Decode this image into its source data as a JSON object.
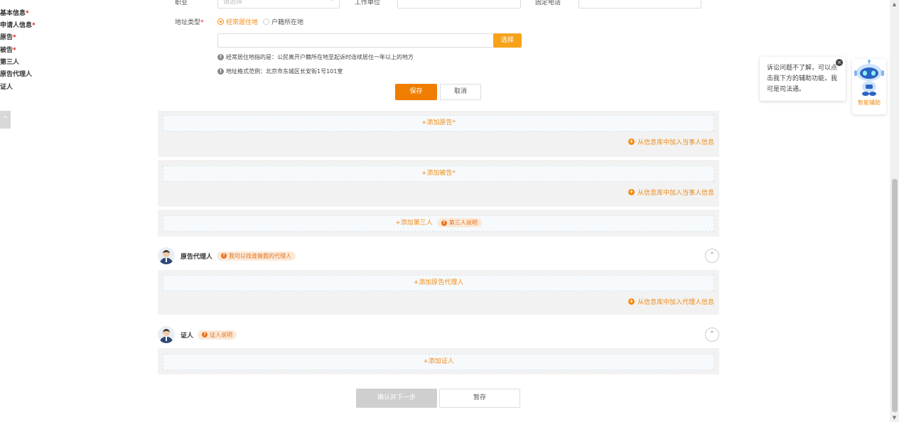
{
  "nav": {
    "items": [
      {
        "label": "基本信息",
        "required": true
      },
      {
        "label": "申请人信息",
        "required": true
      },
      {
        "label": "原告",
        "required": true
      },
      {
        "label": "被告",
        "required": true
      },
      {
        "label": "第三人",
        "required": false
      },
      {
        "label": "原告代理人",
        "required": false
      },
      {
        "label": "证人",
        "required": false
      }
    ],
    "back_top": "^"
  },
  "form": {
    "occupation_label": "职业",
    "occupation_placeholder": "请选择",
    "employer_label": "工作单位",
    "phone_label": "固定电话",
    "address_type_label": "地址类型",
    "required_mark": "*",
    "radio_habitual": "经常居住地",
    "radio_household": "户籍所在地",
    "select_button": "选择",
    "info_1": "经常居住地指的是：公民离开户籍所在地至起诉时连续居住一年以上的地方",
    "info_2": "地址格式范例：北京市东城区长安街1号101室",
    "save_button": "保存",
    "cancel_button": "取消"
  },
  "plaintiff": {
    "add_label": "+添加原告",
    "from_library": "从信息库中加入当事人信息"
  },
  "defendant": {
    "add_label": "+添加被告",
    "from_library": "从信息库中加入当事人信息"
  },
  "third_party": {
    "add_label": "+添加第三人",
    "help_pill": "第三人说明"
  },
  "plaintiff_agent": {
    "title": "原告代理人",
    "help_pill": "我可以找谁做我的代理人",
    "add_label": "+添加原告代理人",
    "from_library": "从信息库中加入代理人信息"
  },
  "witness": {
    "title": "证人",
    "help_pill": "证人说明",
    "add_label": "+添加证人"
  },
  "footer": {
    "confirm_button": "确认并下一步",
    "draft_button": "暂存"
  },
  "assistant": {
    "bubble_text": "诉讼问题不了解，可以点击我下方的辅助功能，我可是司法通。",
    "close": "×",
    "label": "智能辅助"
  },
  "colors": {
    "accent": "#ef7d00",
    "accent_light": "#f7a21a",
    "required": "#e02020",
    "section_bg": "#f2f2f2"
  }
}
